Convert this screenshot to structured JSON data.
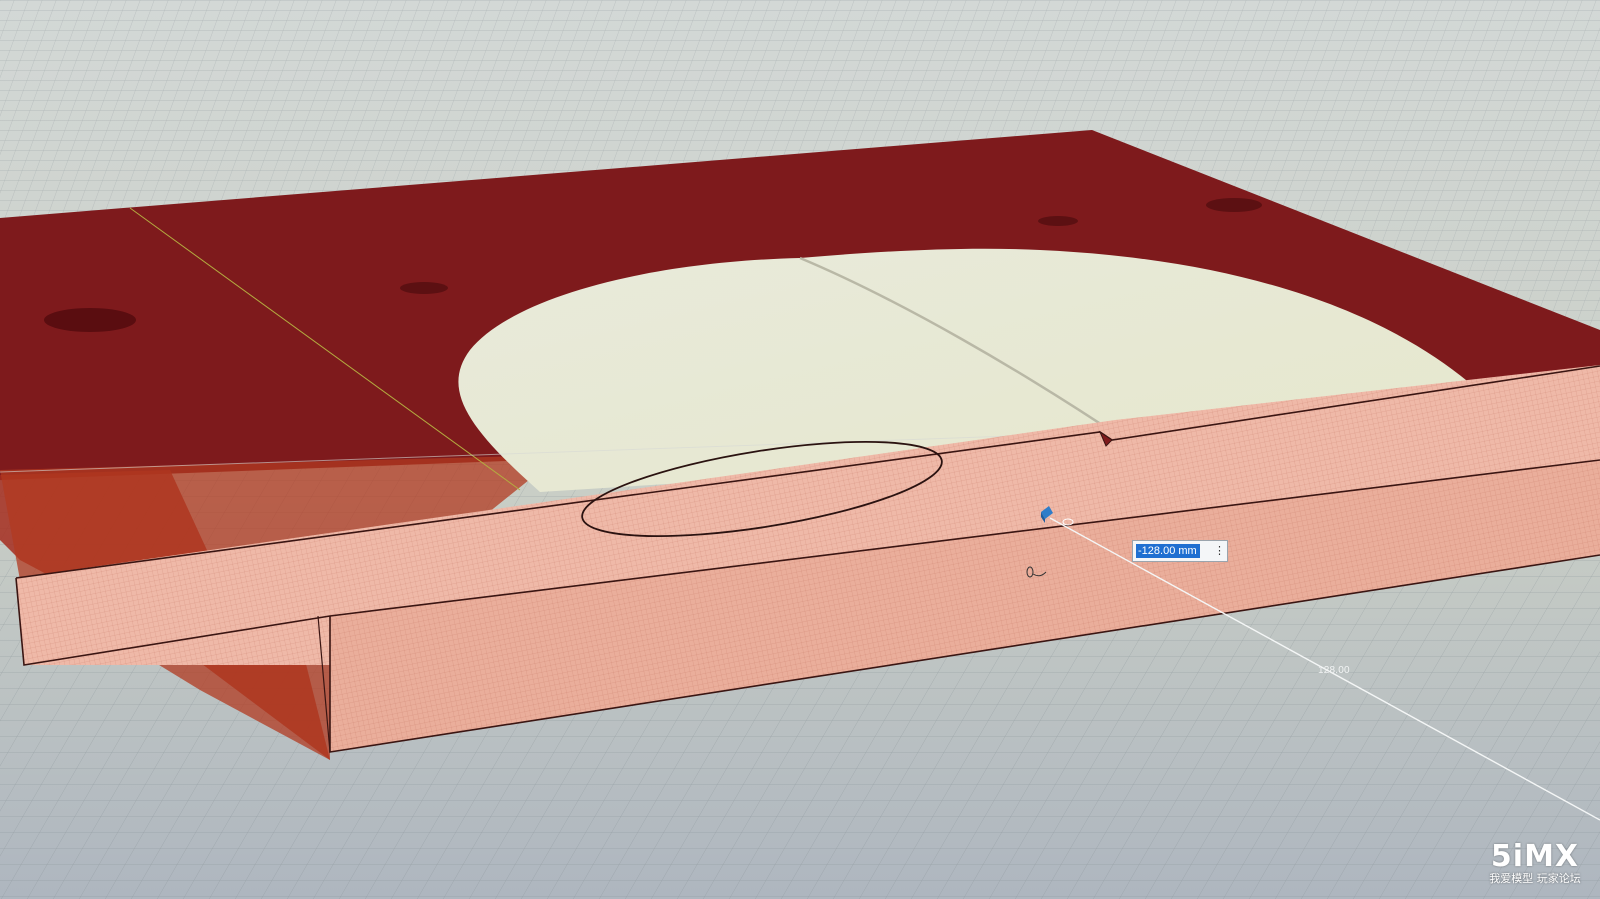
{
  "viewport": {
    "background": "#c7cccc",
    "colors": {
      "plate": "#7e1a1c",
      "plate_shadow": "#8c2318",
      "flange": "#efb9a8",
      "flange_edge": "#3a1512",
      "cutout": "#e5e7d2",
      "grid": "#8f9a9d"
    }
  },
  "dimension_input": {
    "value": "-128.00 mm",
    "menu_icon": "kebab-menu-icon"
  },
  "dimension_label": "128.00",
  "cursor_icon": "move-arrow-icon",
  "watermark": {
    "logo": "5iMX",
    "tagline": "我爱模型 玩家论坛"
  }
}
